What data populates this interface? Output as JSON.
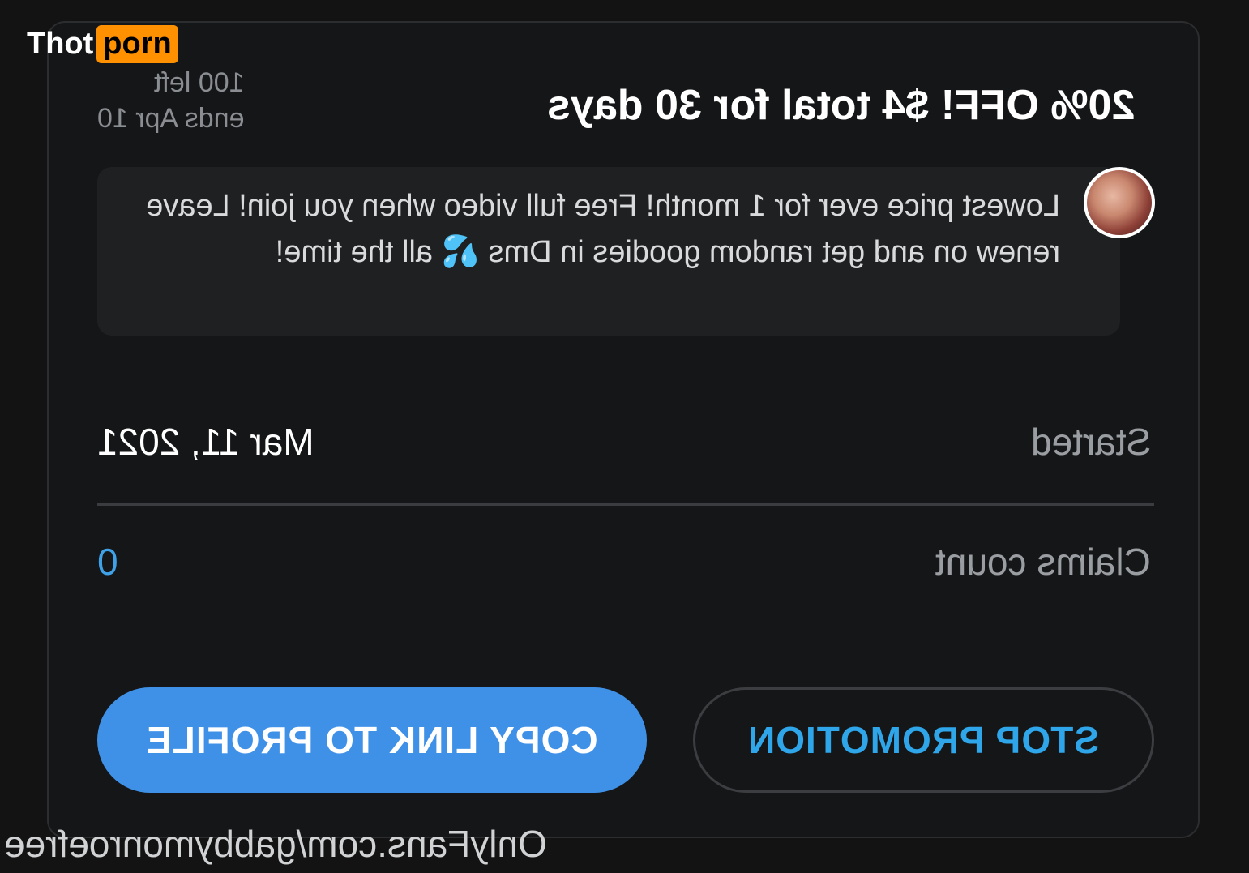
{
  "brand": {
    "part1": "Thot",
    "part2": "porn",
    "accent_color": "#ff9000"
  },
  "promo": {
    "remaining": "100 left",
    "ends": "ends Apr 10",
    "title": "20% OFF! $4 total for 30 days",
    "message": "Lowest price ever for 1 month! Free full video when you join! Leave renew on and get random goodies in Dms 💦 all the time!",
    "avatar_icon": "profile-avatar"
  },
  "details": {
    "started_label": "Started",
    "started_value": "Mar 11, 2021",
    "claims_label": "Claims count",
    "claims_value": "0",
    "claims_color": "#3fa2e8"
  },
  "actions": {
    "copy_label": "COPY LINK TO PROFILE",
    "stop_label": "STOP PROMOTION",
    "primary_color": "#3f91e8",
    "stop_color": "#2fa6ea"
  },
  "watermark": {
    "text": "OnlyFans.com/gabbymonroefree"
  }
}
